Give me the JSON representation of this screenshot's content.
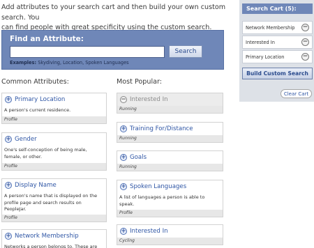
{
  "intro": {
    "line1": "Add attributes to your search cart and then build your own custom search. You",
    "line2": "can find people with great specificity using the custom search."
  },
  "finder": {
    "title": "Find an Attribute:",
    "input_value": "",
    "search_label": "Search",
    "examples_label": "Examples:",
    "examples_text": "Skydiving, Location, Spoken Languages"
  },
  "common": {
    "heading": "Common Attributes:",
    "cards": [
      {
        "title": "Primary Location",
        "desc": "A person's current residence.",
        "category": "Profile"
      },
      {
        "title": "Gender",
        "desc": "One's self-conception of being male, female, or other.",
        "category": "Profile"
      },
      {
        "title": "Display Name",
        "desc": "A person's name that is displayed on the profile page and search results on PeopleJar.",
        "category": "Profile"
      },
      {
        "title": "Network Membership",
        "desc": "Networks a person belongs to. These are",
        "category": ""
      }
    ]
  },
  "popular": {
    "heading": "Most Popular:",
    "cards": [
      {
        "title": "Interested In",
        "category": "Running",
        "state": "added"
      },
      {
        "title": "Training For/Distance",
        "category": "Running"
      },
      {
        "title": "Goals",
        "category": "Running"
      },
      {
        "title": "Spoken Languages",
        "desc": "A list of languages a person is able to speak.",
        "category": "Profile"
      },
      {
        "title": "Interested In",
        "category": "Cycling"
      }
    ]
  },
  "cart": {
    "title": "Search Cart (5):",
    "items": [
      "Network Membership",
      "Interested In",
      "Primary Location"
    ],
    "build_label": "Build Custom Search",
    "clear_label": "Clear Cart"
  },
  "colors": {
    "accent": "#6f87b8",
    "link": "#2f56a5",
    "cart_bg": "#dde1e7"
  },
  "icons": {
    "add": "plus-circle-icon",
    "remove": "minus-circle-icon"
  }
}
